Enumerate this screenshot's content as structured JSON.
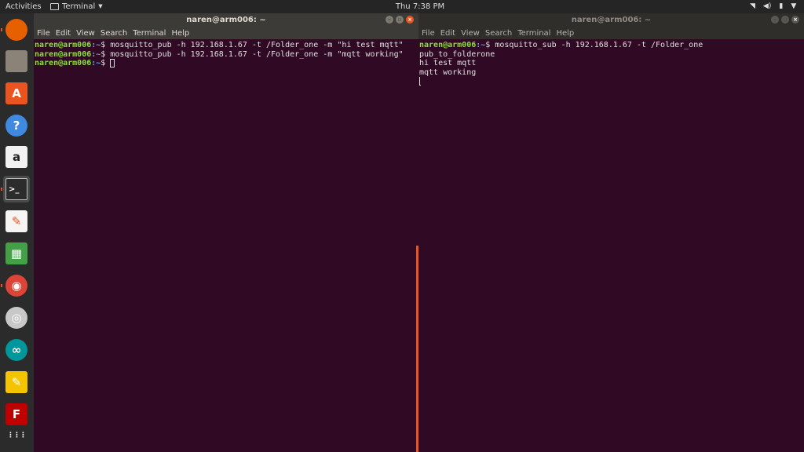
{
  "topbar": {
    "activities": "Activities",
    "app_name": "Terminal",
    "clock": "Thu  7:38 PM",
    "tray_icons": [
      "wifi-icon",
      "volume-icon",
      "battery-icon",
      "power-menu-icon"
    ]
  },
  "dock": {
    "items": [
      {
        "name": "firefox-icon",
        "glyph": "",
        "color": "#e66000"
      },
      {
        "name": "files-icon",
        "glyph": "",
        "color": "#8b8378"
      },
      {
        "name": "software-center-icon",
        "glyph": "A",
        "color": "#e95420"
      },
      {
        "name": "help-icon",
        "glyph": "?",
        "color": "#3f8ae0"
      },
      {
        "name": "amazon-icon",
        "glyph": "a",
        "color": "#f2f2f2"
      },
      {
        "name": "terminal-icon",
        "glyph": ">_",
        "color": "#2c2c2c"
      },
      {
        "name": "text-editor-icon",
        "glyph": "✎",
        "color": "#f6f5f4"
      },
      {
        "name": "spreadsheet-icon",
        "glyph": "▦",
        "color": "#43a047"
      },
      {
        "name": "chrome-icon",
        "glyph": "◉",
        "color": "#db4437"
      },
      {
        "name": "audio-player-icon",
        "glyph": "◎",
        "color": "#c8c8c8"
      },
      {
        "name": "arduino-icon",
        "glyph": "∞",
        "color": "#00979c"
      },
      {
        "name": "notes-icon",
        "glyph": "✎",
        "color": "#f5c400"
      },
      {
        "name": "filezilla-icon",
        "glyph": "F",
        "color": "#bf0000"
      },
      {
        "name": "show-apps-icon",
        "glyph": "⋮⋮⋮",
        "color": "transparent"
      }
    ]
  },
  "left_terminal": {
    "title": "naren@arm006: ~",
    "menu": [
      "File",
      "Edit",
      "View",
      "Search",
      "Terminal",
      "Help"
    ],
    "lines": [
      {
        "user": "naren@arm006",
        "path": ":~",
        "cmd": "$ mosquitto_pub -h 192.168.1.67 -t /Folder_one -m \"hi test mqtt\""
      },
      {
        "user": "naren@arm006",
        "path": ":~",
        "cmd": "$ mosquitto_pub -h 192.168.1.67 -t /Folder_one -m \"mqtt working\""
      },
      {
        "user": "naren@arm006",
        "path": ":~",
        "cmd": "$ "
      }
    ]
  },
  "right_terminal": {
    "title": "naren@arm006: ~",
    "menu": [
      "File",
      "Edit",
      "View",
      "Search",
      "Terminal",
      "Help"
    ],
    "prompt": {
      "user": "naren@arm006",
      "path": ":~",
      "cmd": "$ mosquitto_sub -h 192.168.1.67 -t /Folder_one"
    },
    "output": [
      "pub_to_folderone",
      "hi test mqtt",
      "mqtt working"
    ]
  },
  "colors": {
    "terminal_bg": "#300a24",
    "accent": "#e95420",
    "prompt_user": "#8ae234",
    "prompt_path": "#729fcf"
  }
}
